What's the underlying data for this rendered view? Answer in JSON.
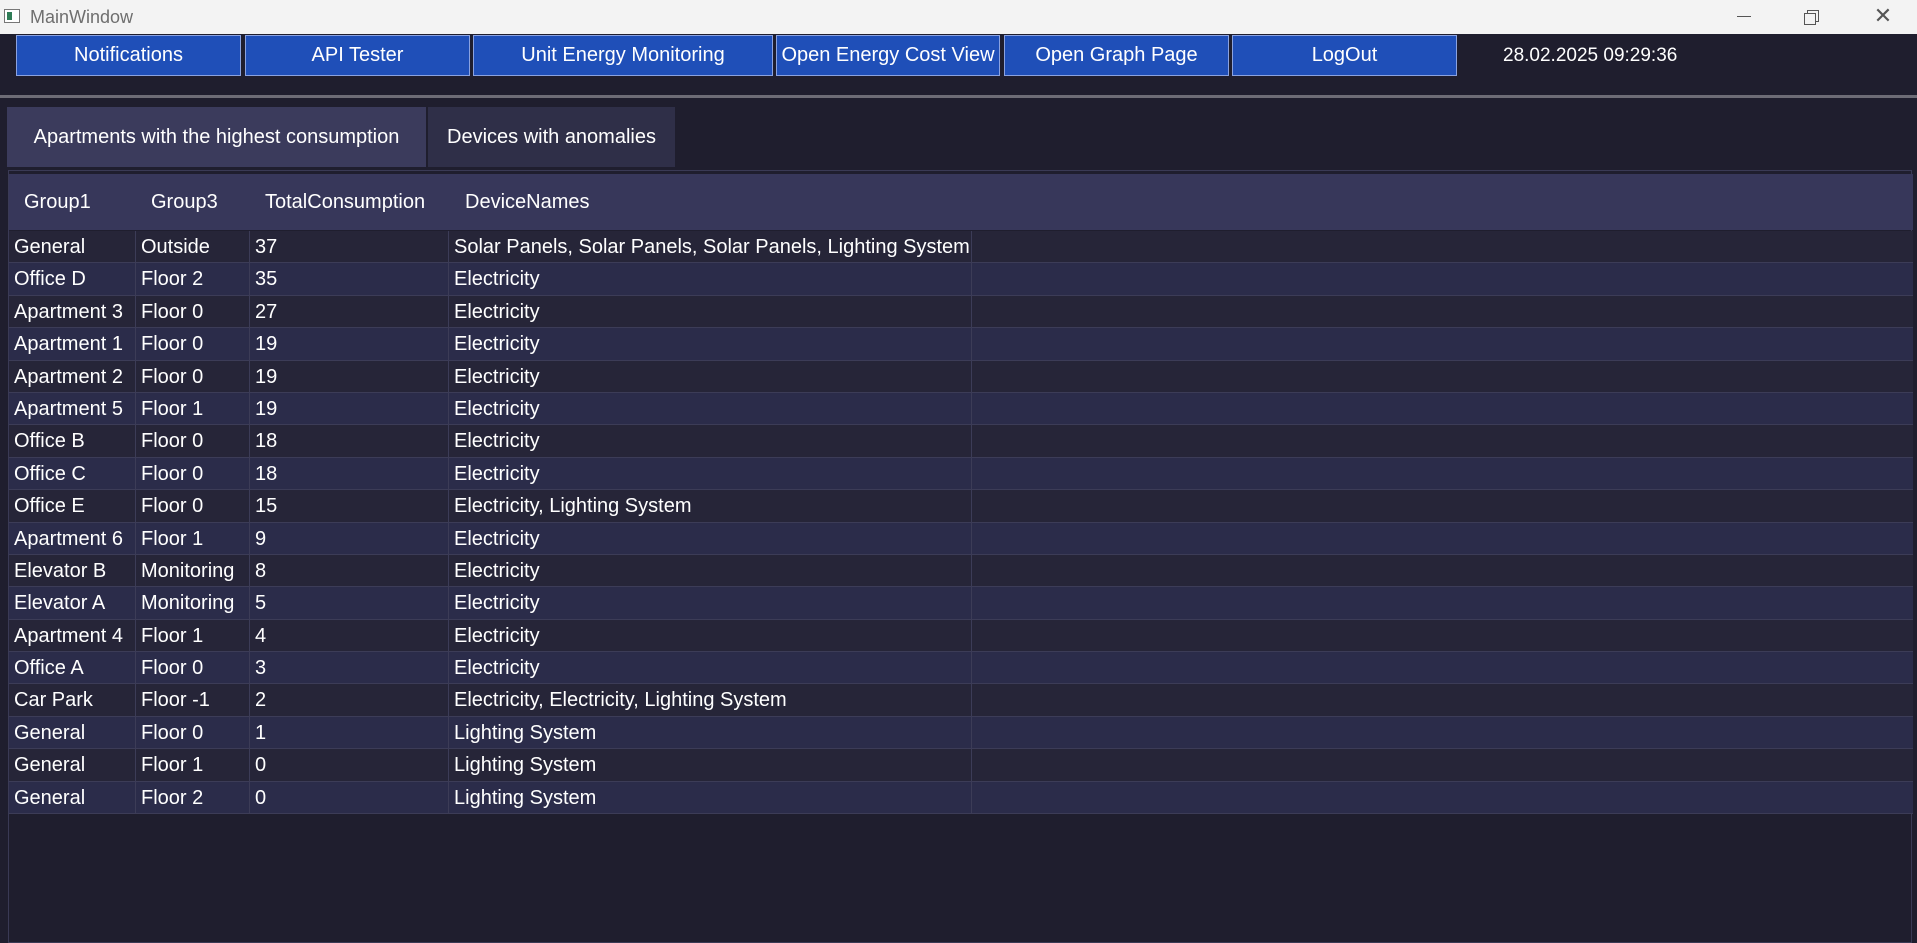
{
  "window": {
    "title": "MainWindow",
    "minimize_icon": "minimize-icon",
    "maximize_icon": "restore-icon",
    "close_icon": "close-icon",
    "close_glyph": "✕"
  },
  "toolbar": {
    "buttons": [
      {
        "label": "Notifications"
      },
      {
        "label": "API Tester"
      },
      {
        "label": "Unit Energy Monitoring"
      },
      {
        "label": "Open Energy Cost View"
      },
      {
        "label": "Open Graph Page"
      },
      {
        "label": "LogOut"
      }
    ],
    "datetime": "28.02.2025 09:29:36",
    "button_color": "#1f4fb8"
  },
  "tabs": [
    {
      "label": "Apartments with the highest consumption",
      "selected": true
    },
    {
      "label": "Devices with anomalies",
      "selected": false
    }
  ],
  "table": {
    "columns": [
      "Group1",
      "Group3",
      "TotalConsumption",
      "DeviceNames"
    ],
    "rows": [
      [
        "General",
        "Outside",
        "37",
        "Solar Panels, Solar Panels, Solar Panels, Lighting System"
      ],
      [
        "Office D",
        "Floor 2",
        "35",
        "Electricity"
      ],
      [
        "Apartment 3",
        "Floor 0",
        "27",
        "Electricity"
      ],
      [
        "Apartment 1",
        "Floor 0",
        "19",
        "Electricity"
      ],
      [
        "Apartment 2",
        "Floor 0",
        "19",
        "Electricity"
      ],
      [
        "Apartment 5",
        "Floor 1",
        "19",
        "Electricity"
      ],
      [
        "Office B",
        "Floor 0",
        "18",
        "Electricity"
      ],
      [
        "Office C",
        "Floor 0",
        "18",
        "Electricity"
      ],
      [
        "Office E",
        "Floor 0",
        "15",
        "Electricity, Lighting System"
      ],
      [
        "Apartment 6",
        "Floor 1",
        "9",
        "Electricity"
      ],
      [
        "Elevator B",
        "Monitoring",
        "8",
        "Electricity"
      ],
      [
        "Elevator A",
        "Monitoring",
        "5",
        "Electricity"
      ],
      [
        "Apartment 4",
        "Floor 1",
        "4",
        "Electricity"
      ],
      [
        "Office A",
        "Floor 0",
        "3",
        "Electricity"
      ],
      [
        "Car Park",
        "Floor -1",
        "2",
        "Electricity, Electricity, Lighting System"
      ],
      [
        "General",
        "Floor 0",
        "1",
        "Lighting System"
      ],
      [
        "General",
        "Floor 1",
        "0",
        "Lighting System"
      ],
      [
        "General",
        "Floor 2",
        "0",
        "Lighting System"
      ]
    ]
  }
}
